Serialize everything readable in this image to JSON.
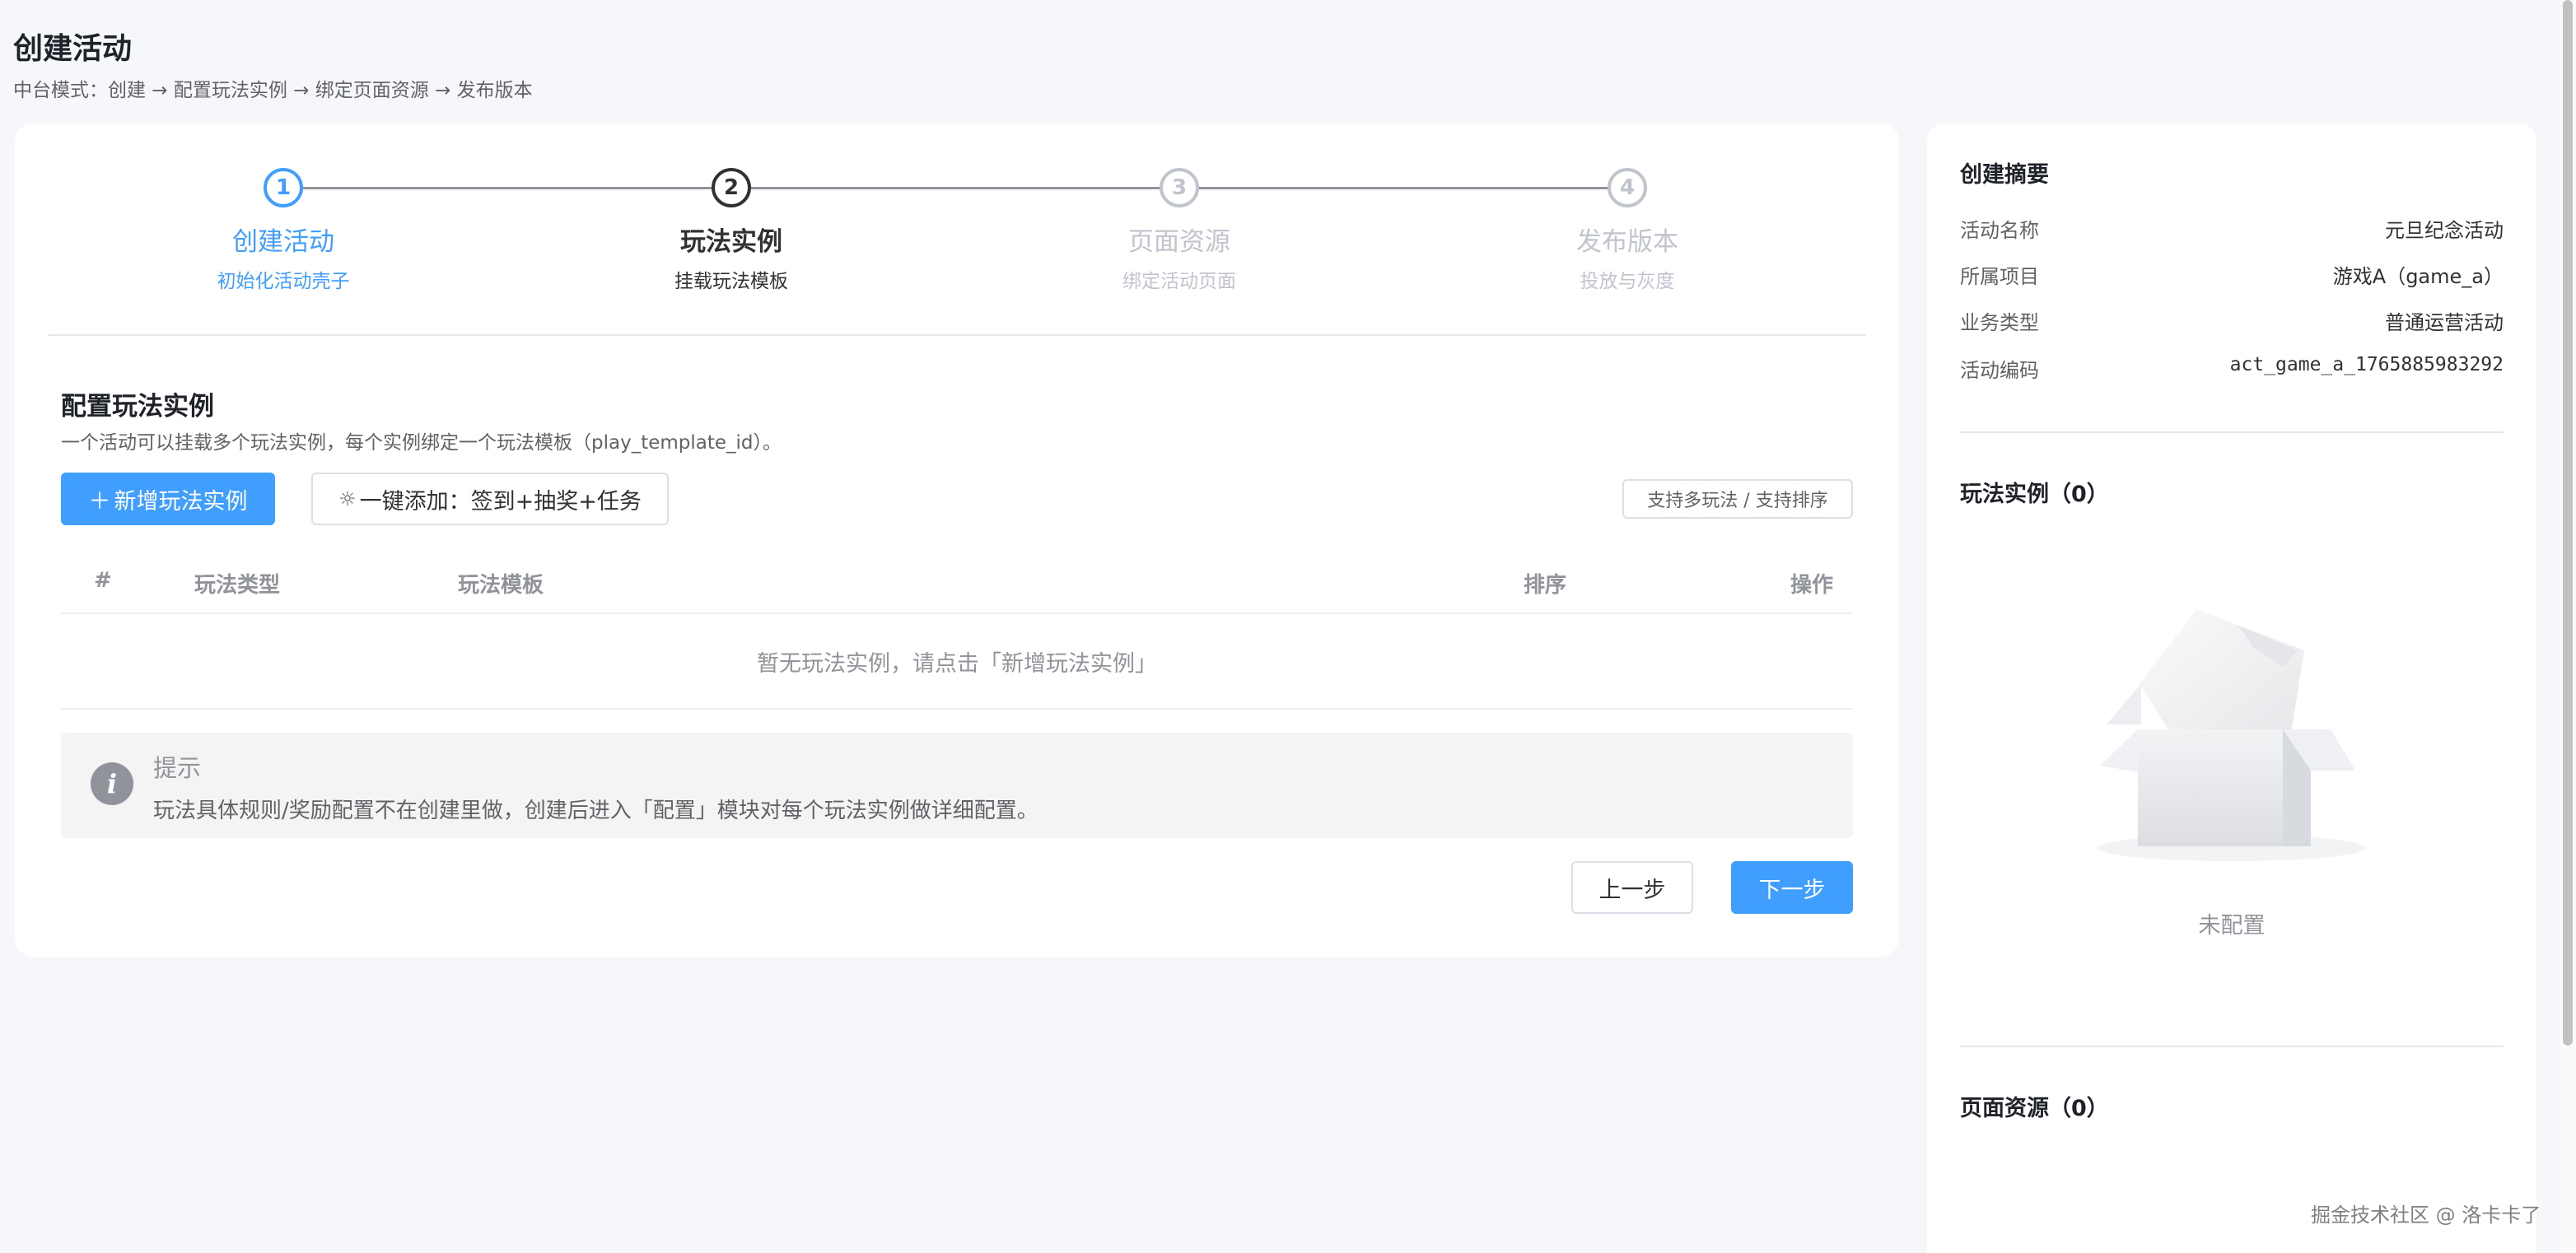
{
  "header": {
    "title": "创建活动",
    "subtitle": "中台模式：创建 → 配置玩法实例 → 绑定页面资源 → 发布版本"
  },
  "steps": [
    {
      "num": "1",
      "title": "创建活动",
      "desc": "初始化活动壳子",
      "state": "done"
    },
    {
      "num": "2",
      "title": "玩法实例",
      "desc": "挂载玩法模板",
      "state": "current"
    },
    {
      "num": "3",
      "title": "页面资源",
      "desc": "绑定活动页面",
      "state": "pending"
    },
    {
      "num": "4",
      "title": "发布版本",
      "desc": "投放与灰度",
      "state": "pending"
    }
  ],
  "section": {
    "title": "配置玩法实例",
    "desc": "一个活动可以挂载多个玩法实例，每个实例绑定一个玩法模板（play_template_id）。",
    "add_button": "新增玩法实例",
    "quick_button": "一键添加：签到+抽奖+任务",
    "support_tag": "支持多玩法 / 支持排序"
  },
  "table": {
    "columns": [
      "#",
      "玩法类型",
      "玩法模板",
      "排序",
      "操作"
    ],
    "empty_text": "暂无玩法实例，请点击「新增玩法实例」"
  },
  "alert": {
    "title": "提示",
    "text": "玩法具体规则/奖励配置不在创建里做，创建后进入「配置」模块对每个玩法实例做详细配置。"
  },
  "nav": {
    "prev": "上一步",
    "next": "下一步"
  },
  "summary": {
    "title": "创建摘要",
    "items": [
      {
        "label": "活动名称",
        "value": "元旦纪念活动"
      },
      {
        "label": "所属项目",
        "value": "游戏A（game_a）"
      },
      {
        "label": "业务类型",
        "value": "普通运营活动"
      },
      {
        "label": "活动编码",
        "value": "act_game_a_1765885983292"
      }
    ],
    "play_section": "玩法实例（0）",
    "empty_text": "未配置",
    "page_section": "页面资源（0）"
  },
  "watermark": "掘金技术社区 @ 洛卡卡了",
  "colors": {
    "primary": "#409eff",
    "text": "#303133",
    "muted": "#909399",
    "background": "#f5f7fa"
  }
}
